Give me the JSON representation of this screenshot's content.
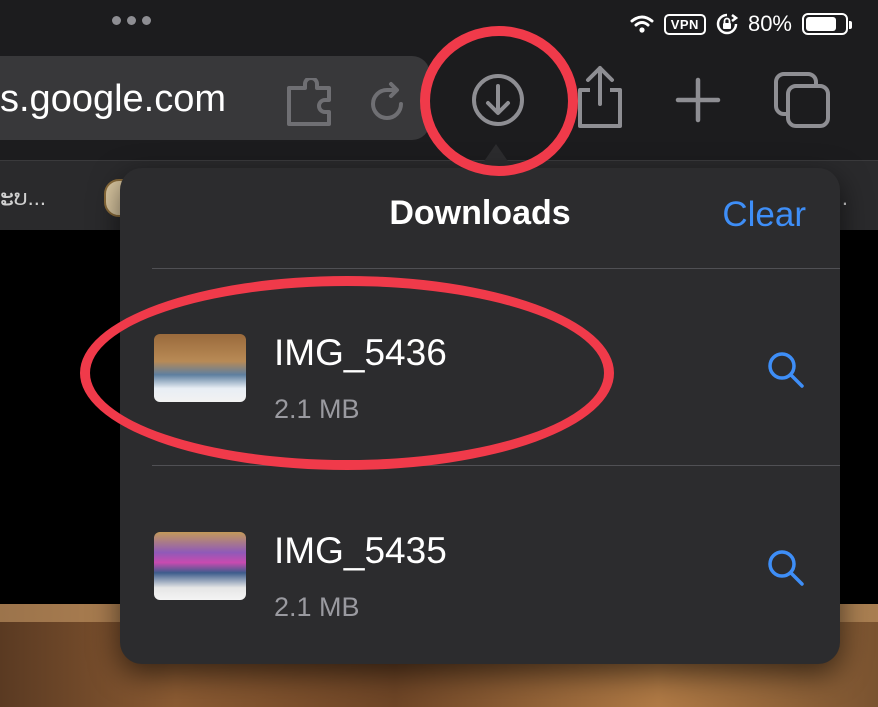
{
  "status_bar": {
    "battery_text": "80%",
    "vpn_label": "VPN",
    "battery_level": 0.8
  },
  "toolbar": {
    "url_text": "s.google.com"
  },
  "tab_bar": {
    "left_tab_text": "ະບ...",
    "right_tab_text": "..."
  },
  "downloads": {
    "title": "Downloads",
    "clear_label": "Clear",
    "items": [
      {
        "name": "IMG_5436",
        "size": "2.1 MB",
        "thumb_icon": "photo-thumbnail"
      },
      {
        "name": "IMG_5435",
        "size": "2.1 MB",
        "thumb_icon": "photo-thumbnail"
      }
    ]
  },
  "colors": {
    "accent": "#3e8ef7",
    "annotation": "#f03a4a",
    "popover_bg": "#2c2c2e"
  },
  "icons": [
    "wifi-icon",
    "rotation-lock-icon",
    "battery-icon",
    "extension-icon",
    "reload-icon",
    "download-icon",
    "share-icon",
    "new-tab-icon",
    "tabs-icon",
    "search-icon"
  ]
}
